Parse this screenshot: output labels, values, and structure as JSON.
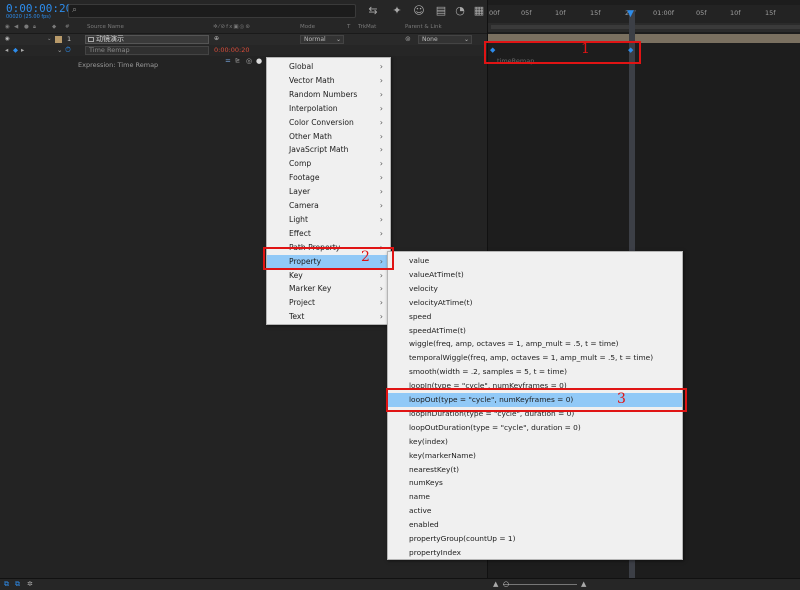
{
  "header": {
    "timecode": "0:00:00:20",
    "fps_info": "00020 (25.00 fps)",
    "search_icon": "search-icon"
  },
  "columns": {
    "num": "#",
    "source_name": "Source Name",
    "mode": "Mode",
    "t": "T",
    "trkmat": "TrkMat",
    "parent": "Parent & Link"
  },
  "layer": {
    "index": "1",
    "name": "动镜演示",
    "mode": "Normal",
    "parent": "None"
  },
  "property": {
    "name": "Time Remap",
    "value": "0:00:00:20",
    "expression_label": "Expression: Time Remap"
  },
  "timeline": {
    "ticks": [
      "00f",
      "05f",
      "10f",
      "15f",
      "20f",
      "01:00f",
      "05f",
      "10f",
      "15f"
    ],
    "property_label": "timeRemap"
  },
  "menu_categories": [
    {
      "label": "Global"
    },
    {
      "label": "Vector Math"
    },
    {
      "label": "Random Numbers"
    },
    {
      "label": "Interpolation"
    },
    {
      "label": "Color Conversion"
    },
    {
      "label": "Other Math"
    },
    {
      "label": "JavaScript Math"
    },
    {
      "label": "Comp"
    },
    {
      "label": "Footage"
    },
    {
      "label": "Layer"
    },
    {
      "label": "Camera"
    },
    {
      "label": "Light"
    },
    {
      "label": "Effect"
    },
    {
      "label": "Path Property"
    },
    {
      "label": "Property"
    },
    {
      "label": "Key"
    },
    {
      "label": "Marker Key"
    },
    {
      "label": "Project"
    },
    {
      "label": "Text"
    }
  ],
  "menu_arrow": "›",
  "menu_property": [
    {
      "label": "value"
    },
    {
      "label": "valueAtTime(t)"
    },
    {
      "label": "velocity"
    },
    {
      "label": "velocityAtTime(t)"
    },
    {
      "label": "speed"
    },
    {
      "label": "speedAtTime(t)"
    },
    {
      "label": "wiggle(freq, amp, octaves = 1, amp_mult = .5, t = time)"
    },
    {
      "label": "temporalWiggle(freq, amp, octaves = 1, amp_mult = .5, t = time)"
    },
    {
      "label": "smooth(width = .2, samples = 5, t = time)"
    },
    {
      "label": "loopIn(type = \"cycle\", numKeyframes = 0)"
    },
    {
      "label": "loopOut(type = \"cycle\", numKeyframes = 0)"
    },
    {
      "label": "loopInDuration(type = \"cycle\", duration = 0)"
    },
    {
      "label": "loopOutDuration(type = \"cycle\", duration = 0)"
    },
    {
      "label": "key(index)"
    },
    {
      "label": "key(markerName)"
    },
    {
      "label": "nearestKey(t)"
    },
    {
      "label": "numKeys"
    },
    {
      "label": "name"
    },
    {
      "label": "active"
    },
    {
      "label": "enabled"
    },
    {
      "label": "propertyGroup(countUp = 1)"
    },
    {
      "label": "propertyIndex"
    }
  ],
  "annotations": {
    "a1": "1",
    "a2": "2",
    "a3": "3"
  },
  "colors": {
    "accent": "#2d8ceb",
    "highlight": "#91c9f7",
    "annotation": "#e01414",
    "value_red": "#d94c3a"
  }
}
